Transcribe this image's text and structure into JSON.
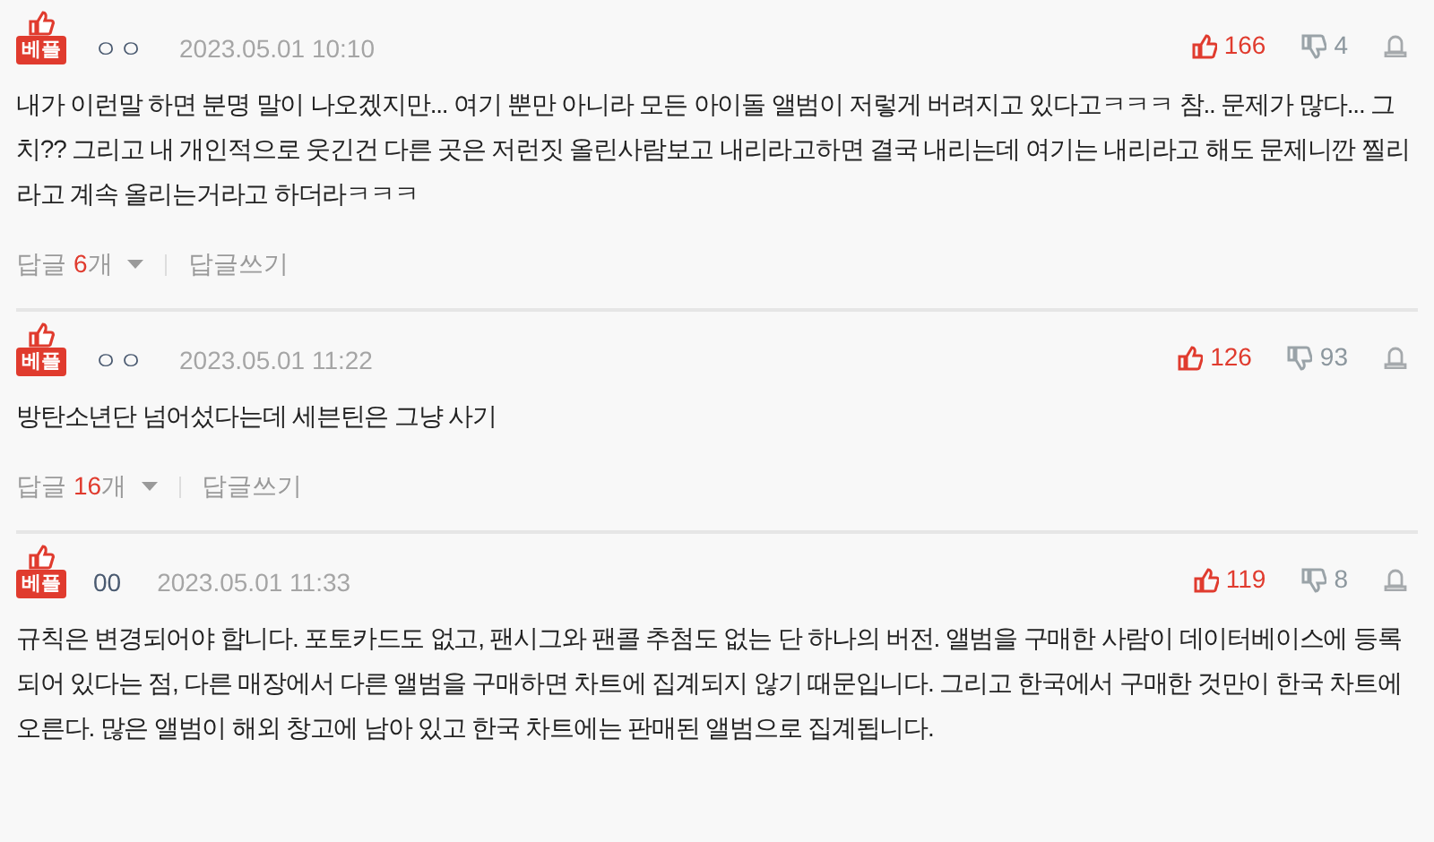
{
  "comments": [
    {
      "badge": "베플",
      "user": "ㅇㅇ",
      "date": "2023.05.01 10:10",
      "text": "내가 이런말 하면 분명 말이 나오겠지만... 여기 뿐만 아니라 모든 아이돌 앨범이 저렇게 버려지고 있다고ㅋㅋㅋ 참.. 문제가 많다... 그치?? 그리고 내 개인적으로 웃긴건 다른 곳은 저런짓 올린사람보고 내리라고하면 결국 내리는데 여기는 내리라고 해도 문제니깐 찔리라고 계속 올리는거라고 하더라ㅋㅋㅋ",
      "likes": "166",
      "dislikes": "4",
      "replies": {
        "label": "답글",
        "count": "6",
        "unit": "개",
        "write": "답글쓰기"
      }
    },
    {
      "badge": "베플",
      "user": "ㅇㅇ",
      "date": "2023.05.01 11:22",
      "text": "방탄소년단 넘어섰다는데 세븐틴은 그냥 사기",
      "likes": "126",
      "dislikes": "93",
      "replies": {
        "label": "답글",
        "count": "16",
        "unit": "개",
        "write": "답글쓰기"
      }
    },
    {
      "badge": "베플",
      "user": "00",
      "date": "2023.05.01 11:33",
      "text": "규칙은 변경되어야 합니다. 포토카드도 없고, 팬시그와 팬콜 추첨도 없는 단 하나의 버전. 앨범을 구매한 사람이 데이터베이스에 등록되어 있다는 점, 다른 매장에서 다른 앨범을 구매하면 차트에 집계되지 않기 때문입니다. 그리고 한국에서 구매한 것만이 한국 차트에 오른다. 많은 앨범이 해외 창고에 남아 있고 한국 차트에는 판매된 앨범으로 집계됩니다.",
      "likes": "119",
      "dislikes": "8"
    }
  ]
}
